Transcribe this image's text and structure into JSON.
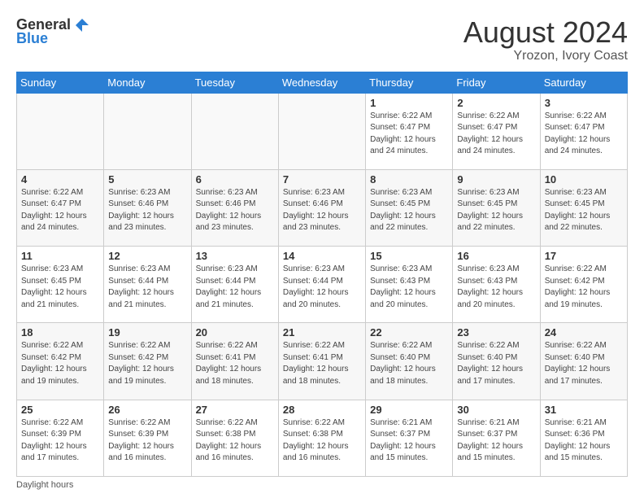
{
  "logo": {
    "general": "General",
    "blue": "Blue"
  },
  "header": {
    "month_year": "August 2024",
    "location": "Yrozon, Ivory Coast"
  },
  "days_of_week": [
    "Sunday",
    "Monday",
    "Tuesday",
    "Wednesday",
    "Thursday",
    "Friday",
    "Saturday"
  ],
  "footer": {
    "daylight_label": "Daylight hours"
  },
  "weeks": [
    [
      {
        "day": "",
        "info": ""
      },
      {
        "day": "",
        "info": ""
      },
      {
        "day": "",
        "info": ""
      },
      {
        "day": "",
        "info": ""
      },
      {
        "day": "1",
        "info": "Sunrise: 6:22 AM\nSunset: 6:47 PM\nDaylight: 12 hours\nand 24 minutes."
      },
      {
        "day": "2",
        "info": "Sunrise: 6:22 AM\nSunset: 6:47 PM\nDaylight: 12 hours\nand 24 minutes."
      },
      {
        "day": "3",
        "info": "Sunrise: 6:22 AM\nSunset: 6:47 PM\nDaylight: 12 hours\nand 24 minutes."
      }
    ],
    [
      {
        "day": "4",
        "info": "Sunrise: 6:22 AM\nSunset: 6:47 PM\nDaylight: 12 hours\nand 24 minutes."
      },
      {
        "day": "5",
        "info": "Sunrise: 6:23 AM\nSunset: 6:46 PM\nDaylight: 12 hours\nand 23 minutes."
      },
      {
        "day": "6",
        "info": "Sunrise: 6:23 AM\nSunset: 6:46 PM\nDaylight: 12 hours\nand 23 minutes."
      },
      {
        "day": "7",
        "info": "Sunrise: 6:23 AM\nSunset: 6:46 PM\nDaylight: 12 hours\nand 23 minutes."
      },
      {
        "day": "8",
        "info": "Sunrise: 6:23 AM\nSunset: 6:45 PM\nDaylight: 12 hours\nand 22 minutes."
      },
      {
        "day": "9",
        "info": "Sunrise: 6:23 AM\nSunset: 6:45 PM\nDaylight: 12 hours\nand 22 minutes."
      },
      {
        "day": "10",
        "info": "Sunrise: 6:23 AM\nSunset: 6:45 PM\nDaylight: 12 hours\nand 22 minutes."
      }
    ],
    [
      {
        "day": "11",
        "info": "Sunrise: 6:23 AM\nSunset: 6:45 PM\nDaylight: 12 hours\nand 21 minutes."
      },
      {
        "day": "12",
        "info": "Sunrise: 6:23 AM\nSunset: 6:44 PM\nDaylight: 12 hours\nand 21 minutes."
      },
      {
        "day": "13",
        "info": "Sunrise: 6:23 AM\nSunset: 6:44 PM\nDaylight: 12 hours\nand 21 minutes."
      },
      {
        "day": "14",
        "info": "Sunrise: 6:23 AM\nSunset: 6:44 PM\nDaylight: 12 hours\nand 20 minutes."
      },
      {
        "day": "15",
        "info": "Sunrise: 6:23 AM\nSunset: 6:43 PM\nDaylight: 12 hours\nand 20 minutes."
      },
      {
        "day": "16",
        "info": "Sunrise: 6:23 AM\nSunset: 6:43 PM\nDaylight: 12 hours\nand 20 minutes."
      },
      {
        "day": "17",
        "info": "Sunrise: 6:22 AM\nSunset: 6:42 PM\nDaylight: 12 hours\nand 19 minutes."
      }
    ],
    [
      {
        "day": "18",
        "info": "Sunrise: 6:22 AM\nSunset: 6:42 PM\nDaylight: 12 hours\nand 19 minutes."
      },
      {
        "day": "19",
        "info": "Sunrise: 6:22 AM\nSunset: 6:42 PM\nDaylight: 12 hours\nand 19 minutes."
      },
      {
        "day": "20",
        "info": "Sunrise: 6:22 AM\nSunset: 6:41 PM\nDaylight: 12 hours\nand 18 minutes."
      },
      {
        "day": "21",
        "info": "Sunrise: 6:22 AM\nSunset: 6:41 PM\nDaylight: 12 hours\nand 18 minutes."
      },
      {
        "day": "22",
        "info": "Sunrise: 6:22 AM\nSunset: 6:40 PM\nDaylight: 12 hours\nand 18 minutes."
      },
      {
        "day": "23",
        "info": "Sunrise: 6:22 AM\nSunset: 6:40 PM\nDaylight: 12 hours\nand 17 minutes."
      },
      {
        "day": "24",
        "info": "Sunrise: 6:22 AM\nSunset: 6:40 PM\nDaylight: 12 hours\nand 17 minutes."
      }
    ],
    [
      {
        "day": "25",
        "info": "Sunrise: 6:22 AM\nSunset: 6:39 PM\nDaylight: 12 hours\nand 17 minutes."
      },
      {
        "day": "26",
        "info": "Sunrise: 6:22 AM\nSunset: 6:39 PM\nDaylight: 12 hours\nand 16 minutes."
      },
      {
        "day": "27",
        "info": "Sunrise: 6:22 AM\nSunset: 6:38 PM\nDaylight: 12 hours\nand 16 minutes."
      },
      {
        "day": "28",
        "info": "Sunrise: 6:22 AM\nSunset: 6:38 PM\nDaylight: 12 hours\nand 16 minutes."
      },
      {
        "day": "29",
        "info": "Sunrise: 6:21 AM\nSunset: 6:37 PM\nDaylight: 12 hours\nand 15 minutes."
      },
      {
        "day": "30",
        "info": "Sunrise: 6:21 AM\nSunset: 6:37 PM\nDaylight: 12 hours\nand 15 minutes."
      },
      {
        "day": "31",
        "info": "Sunrise: 6:21 AM\nSunset: 6:36 PM\nDaylight: 12 hours\nand 15 minutes."
      }
    ]
  ]
}
